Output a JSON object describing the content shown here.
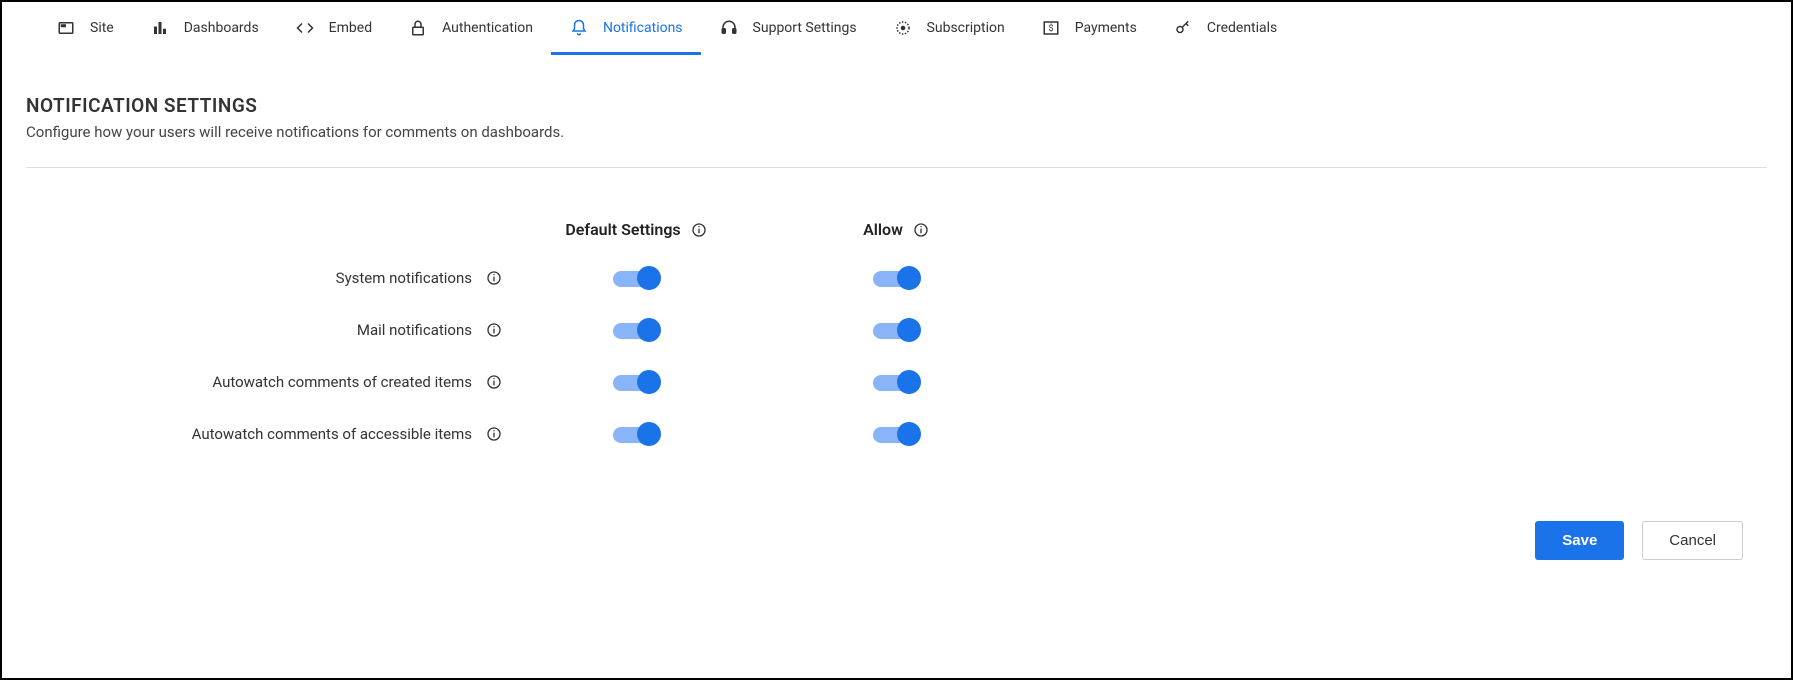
{
  "tabs": [
    {
      "label": "Site"
    },
    {
      "label": "Dashboards"
    },
    {
      "label": "Embed"
    },
    {
      "label": "Authentication"
    },
    {
      "label": "Notifications",
      "active": true
    },
    {
      "label": "Support Settings"
    },
    {
      "label": "Subscription"
    },
    {
      "label": "Payments"
    },
    {
      "label": "Credentials"
    }
  ],
  "section": {
    "title": "NOTIFICATION SETTINGS",
    "subtitle": "Configure how your users will receive notifications for comments on dashboards."
  },
  "columns": {
    "default": "Default Settings",
    "allow": "Allow"
  },
  "rows": [
    {
      "label": "System notifications",
      "default_on": true,
      "allow_on": true
    },
    {
      "label": "Mail notifications",
      "default_on": true,
      "allow_on": true
    },
    {
      "label": "Autowatch comments of created items",
      "default_on": true,
      "allow_on": true
    },
    {
      "label": "Autowatch comments of accessible items",
      "default_on": true,
      "allow_on": true
    }
  ],
  "buttons": {
    "save": "Save",
    "cancel": "Cancel"
  }
}
